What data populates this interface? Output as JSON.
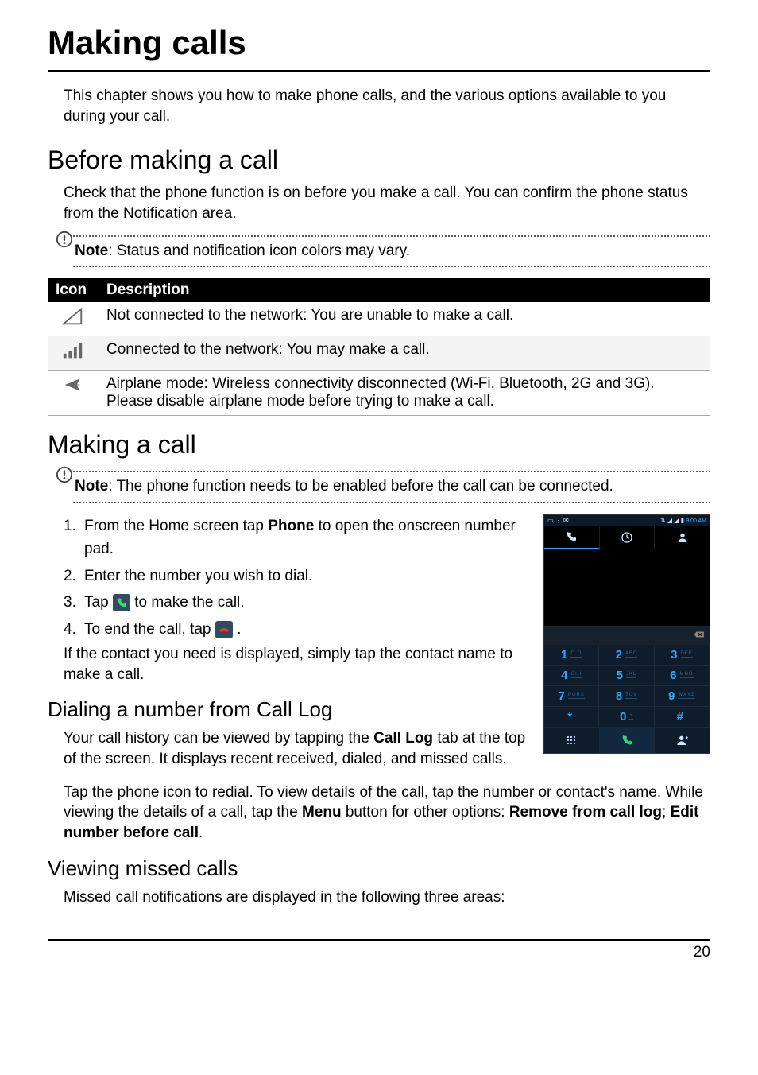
{
  "title": "Making calls",
  "intro": "This chapter shows you how to make phone calls, and the various options available to you during your call.",
  "before": {
    "heading": "Before making a call",
    "text": "Check that the phone function is on before you make a call. You can confirm the phone status from the Notification area."
  },
  "note1": {
    "label": "Note",
    "text": ": Status and notification icon colors may vary."
  },
  "table": {
    "head_icon": "Icon",
    "head_desc": "Description",
    "rows": [
      "Not connected to the network: You are unable to make a call.",
      "Connected to the network: You may make a call.",
      "Airplane mode: Wireless connectivity disconnected (Wi-Fi, Bluetooth, 2G and 3G). Please disable airplane mode before trying to make a call."
    ]
  },
  "making": {
    "heading": "Making a call",
    "note": {
      "label": "Note",
      "text": ": The phone function needs to be enabled before the call can be connected."
    },
    "step1a": "From the Home screen tap ",
    "step1_bold": "Phone",
    "step1b": " to open the onscreen number pad.",
    "step2": "Enter the number you wish to dial.",
    "step3a": "Tap ",
    "step3b": " to make the call.",
    "step4a": "To end the call, tap ",
    "step4b": ".",
    "after_steps": "If the contact you need is displayed, simply tap the contact name to make a call."
  },
  "calllog": {
    "heading": "Dialing a number from Call Log",
    "p1a": "Your call history can be viewed by tapping the ",
    "p1_bold": "Call Log",
    "p1b": " tab at the top of the screen. It displays recent received, dialed, and missed calls.",
    "p2a": "Tap the phone icon to redial. To view details of the call, tap the number or contact's name. While viewing the details of a call, tap the ",
    "p2_bold1": "Menu",
    "p2b": " button for other options: ",
    "p2_bold2": "Remove from call log",
    "p2c": "; ",
    "p2_bold3": "Edit number before call",
    "p2d": "."
  },
  "missed": {
    "heading": "Viewing missed calls",
    "text": "Missed call notifications are displayed in the following three areas:"
  },
  "phone": {
    "time": "9:00 AM",
    "keys": [
      {
        "d": "1",
        "l": "O.O"
      },
      {
        "d": "2",
        "l": "ABC"
      },
      {
        "d": "3",
        "l": "DEF"
      },
      {
        "d": "4",
        "l": "GHI"
      },
      {
        "d": "5",
        "l": "JKL"
      },
      {
        "d": "6",
        "l": "MNO"
      },
      {
        "d": "7",
        "l": "PQRS"
      },
      {
        "d": "8",
        "l": "TUV"
      },
      {
        "d": "9",
        "l": "WXYZ"
      },
      {
        "d": "*",
        "l": ""
      },
      {
        "d": "0",
        "l": "+"
      },
      {
        "d": "#",
        "l": ""
      }
    ]
  },
  "page_number": "20"
}
